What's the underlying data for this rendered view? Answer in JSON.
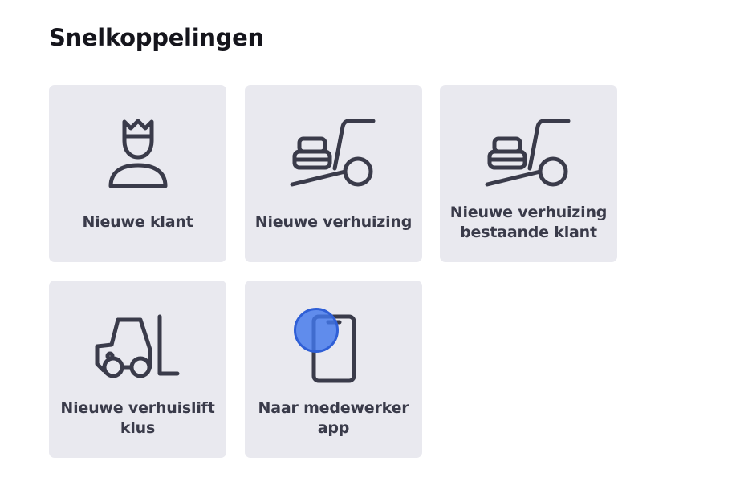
{
  "page": {
    "title": "Snelkoppelingen"
  },
  "tiles": [
    {
      "label": "Nieuwe klant",
      "icon": "person-crown-icon"
    },
    {
      "label": "Nieuwe verhuizing",
      "icon": "moving-dolly-icon"
    },
    {
      "label_line1": "Nieuwe verhuizing",
      "label_line2": "bestaande klant",
      "icon": "moving-dolly-icon"
    },
    {
      "label_line1": "Nieuwe verhuislift",
      "label_line2": "klus",
      "icon": "forklift-icon"
    },
    {
      "label_line1": "Naar medewerker",
      "label_line2": "app",
      "icon": "smartphone-icon"
    }
  ],
  "colors": {
    "tile_background": "#e9e9ef",
    "icon_stroke": "#3a3b4a",
    "cursor_highlight": "#4278eb"
  }
}
